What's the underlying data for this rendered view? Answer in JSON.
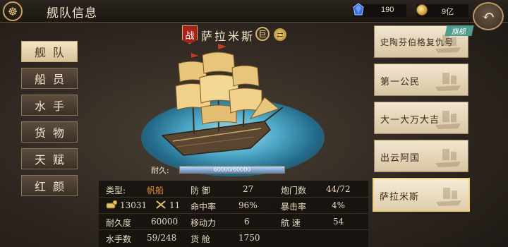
{
  "header": {
    "title": "舰队信息"
  },
  "resources": {
    "gems": "190",
    "gold": "9亿"
  },
  "menu": {
    "items": [
      {
        "label": "舰队"
      },
      {
        "label": "船员"
      },
      {
        "label": "水手"
      },
      {
        "label": "货物"
      },
      {
        "label": "天赋"
      },
      {
        "label": "红颜"
      }
    ],
    "active_index": 0
  },
  "ship": {
    "badge": "战",
    "name": "萨拉米斯",
    "size_badge": "巨",
    "durability_label": "耐久:",
    "durability_text": "60000/60000",
    "durability_fraction": 1.0
  },
  "stats": {
    "type_label": "类型:",
    "type_value": "帆船",
    "defense_label": "防 御",
    "defense_value": "27",
    "cannon_slots_label": "炮门数",
    "cannon_slots_value": "44/72",
    "cargo_cap_value": "13031",
    "cannons_value": "11",
    "hit_rate_label": "命中率",
    "hit_rate_value": "96%",
    "crit_rate_label": "暴击率",
    "crit_rate_value": "4%",
    "durability_label": "耐久度",
    "durability_value": "60000",
    "mobility_label": "移动力",
    "mobility_value": "6",
    "speed_label": "航 速",
    "speed_value": "54",
    "sailors_label": "水手数",
    "sailors_value": "59/248",
    "hold_label": "货 舱",
    "hold_value": "1750"
  },
  "fleet": {
    "flagship_tag": "旗舰",
    "ships": [
      {
        "name": "史陶芬伯格复仇号"
      },
      {
        "name": "第一公民"
      },
      {
        "name": "大一大万大吉"
      },
      {
        "name": "出云阿国"
      },
      {
        "name": "萨拉米斯"
      }
    ],
    "selected_index": 4
  },
  "colors": {
    "accent_orange": "#e28d2e",
    "card_bg": "#efe3ca",
    "flag_tag": "#4f9d8f"
  }
}
